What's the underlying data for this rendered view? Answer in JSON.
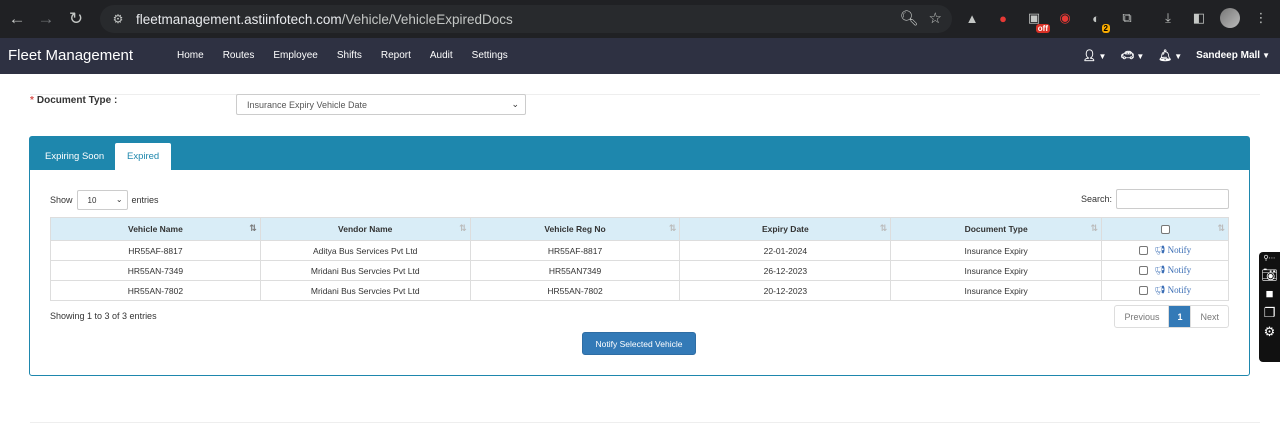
{
  "browser": {
    "url_host": "fleetmanagement.astiinfotech.com",
    "url_path": "/Vehicle/VehicleExpiredDocs",
    "ext_badge_off": "off",
    "ext_badge_count": "2"
  },
  "navbar": {
    "brand": "Fleet Management",
    "menu": [
      "Home",
      "Routes",
      "Employee",
      "Shifts",
      "Report",
      "Audit",
      "Settings"
    ],
    "user": "Sandeep Mall"
  },
  "filter": {
    "label": "Document Type :",
    "required_mark": "*",
    "selected": "Insurance Expiry Vehicle Date"
  },
  "tabs": {
    "expiring": "Expiring Soon",
    "expired": "Expired"
  },
  "table_controls": {
    "show_label": "Show",
    "entries_value": "10",
    "entries_label": "entries",
    "search_label": "Search:"
  },
  "table": {
    "headers": [
      "Vehicle Name",
      "Vendor Name",
      "Vehicle Reg No",
      "Expiry Date",
      "Document Type"
    ],
    "notify_label": "Notify",
    "rows": [
      {
        "vehicle": "HR55AF-8817",
        "vendor": "Aditya Bus Services Pvt Ltd",
        "reg": "HR55AF-8817",
        "expiry": "22-01-2024",
        "doc": "Insurance Expiry"
      },
      {
        "vehicle": "HR55AN-7349",
        "vendor": "Mridani Bus Servcies Pvt Ltd",
        "reg": "HR55AN7349",
        "expiry": "26-12-2023",
        "doc": "Insurance Expiry"
      },
      {
        "vehicle": "HR55AN-7802",
        "vendor": "Mridani Bus Servcies Pvt Ltd",
        "reg": "HR55AN-7802",
        "expiry": "20-12-2023",
        "doc": "Insurance Expiry"
      }
    ]
  },
  "footer": {
    "info": "Showing 1 to 3 of 3 entries",
    "prev": "Previous",
    "page": "1",
    "next": "Next",
    "notify_button": "Notify Selected Vehicle"
  }
}
